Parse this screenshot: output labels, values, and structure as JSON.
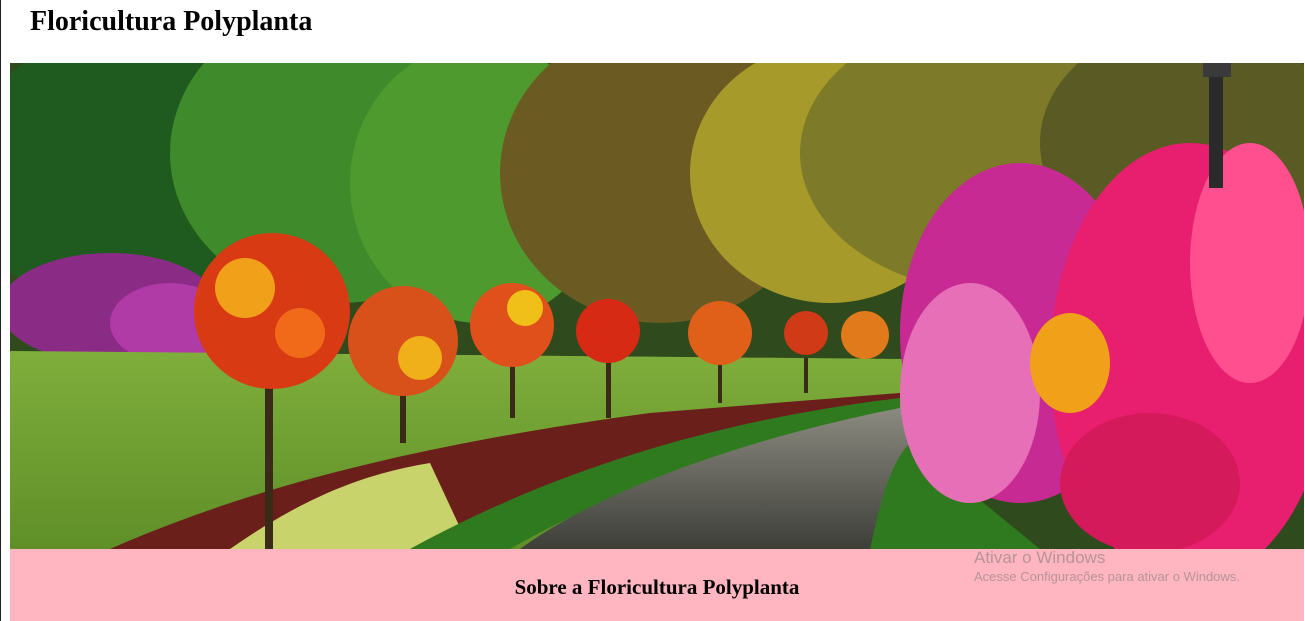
{
  "header": {
    "title": "Floricultura Polyplanta"
  },
  "hero": {
    "image_icon": "garden-photo"
  },
  "about": {
    "heading": "Sobre a Floricultura Polyplanta",
    "band_color": "#ffb6c1"
  },
  "os_watermark": {
    "title": "Ativar o Windows",
    "subtitle": "Acesse Configurações para ativar o Windows."
  }
}
